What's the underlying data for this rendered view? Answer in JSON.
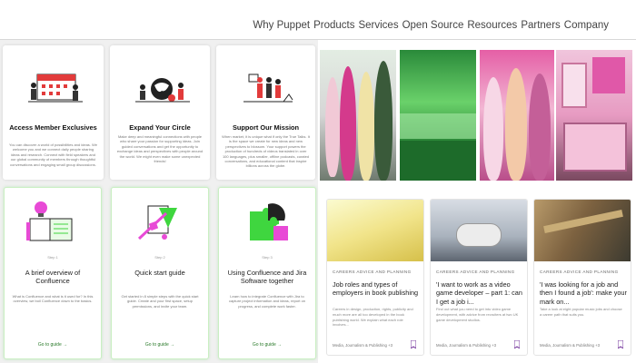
{
  "nav": {
    "links": [
      "Why Puppet",
      "Products",
      "Services",
      "Open Source",
      "Resources",
      "Partners",
      "Company"
    ]
  },
  "feature_cards": [
    {
      "icon": "calendar-people-icon",
      "title": "Access Member Exclusives",
      "body": "You can discover a world of possibilities and ideas. We welcome you and we connect daily people sharing ideas and research. Connect with field speakers and our global community of members through thoughtful conversations and engaging small group discussions."
    },
    {
      "icon": "world-connect-icon",
      "title": "Expand Your Circle",
      "body": "Make deep and meaningful connections with people who share your passion for supporting ideas. Join guided conversations and get the opportunity to exchange ideas and perspectives with people around the world. We might even make some unexpected friends!"
    },
    {
      "icon": "community-mission-icon",
      "title": "Support Our Mission",
      "body": "When market, it is unique what if only the True Talks. It is the space we create for new ideas and new perspectives to blossom. Your support powers the production of hundreds of videos translated in over 100 languages, plus smaller, offline podcasts, curated conversations, and educational content that inspire billions across the globe."
    }
  ],
  "guides": [
    {
      "icon": "book-lightbulb-icon",
      "step": "Step 1",
      "title": "A brief overview of Confluence",
      "body": "What is Confluence and what is it used for? In this overview, we boil Confluence down to the basics.",
      "link": "Go to guide →"
    },
    {
      "icon": "pencil-ruler-icon",
      "step": "Step 2",
      "title": "Quick start guide",
      "body": "Get started in 8 simple steps with the quick start guide. Create and your first space, setup permissions, and invite your team.",
      "link": "Go to guide →"
    },
    {
      "icon": "puzzle-icon",
      "step": "Step 3",
      "title": "Using Confluence and Jira Software together",
      "body": "Learn how to integrate Confluence with Jira to capture project information and ideas, report on progress, and complete work faster.",
      "link": "Go to guide →"
    }
  ],
  "articles": [
    {
      "category": "CAREERS ADVICE AND PLANNING",
      "title": "Job roles and types of employers in book publishing",
      "excerpt": "Careers in design, production, rights, publicity and much more are all too developed in the book publishing world. We explain what each role involves...",
      "meta": "Media, Journalism & Publishing +3",
      "icon": "bookmark-icon"
    },
    {
      "category": "CAREERS ADVICE AND PLANNING",
      "title": "'I want to work as a video game developer – part 1: can I get a job i...",
      "excerpt": "Find out what you need to get into video game development, with advice from recruiters at two UK game development studios.",
      "meta": "Media, Journalism & Publishing +3",
      "icon": "bookmark-icon"
    },
    {
      "category": "CAREERS ADVICE AND PLANNING",
      "title": "'I was looking for a job and then I found a job': make your mark on...",
      "excerpt": "Take a look at eight popular music jobs and choose a career path that suits you.",
      "meta": "Media, Journalism & Publishing +3",
      "icon": "bookmark-icon"
    }
  ],
  "colors": {
    "accent_green": "#2a7a2a",
    "bookmark_purple": "#7b3fa0",
    "guide_magenta": "#e84ad6",
    "guide_green": "#3fd63f"
  }
}
